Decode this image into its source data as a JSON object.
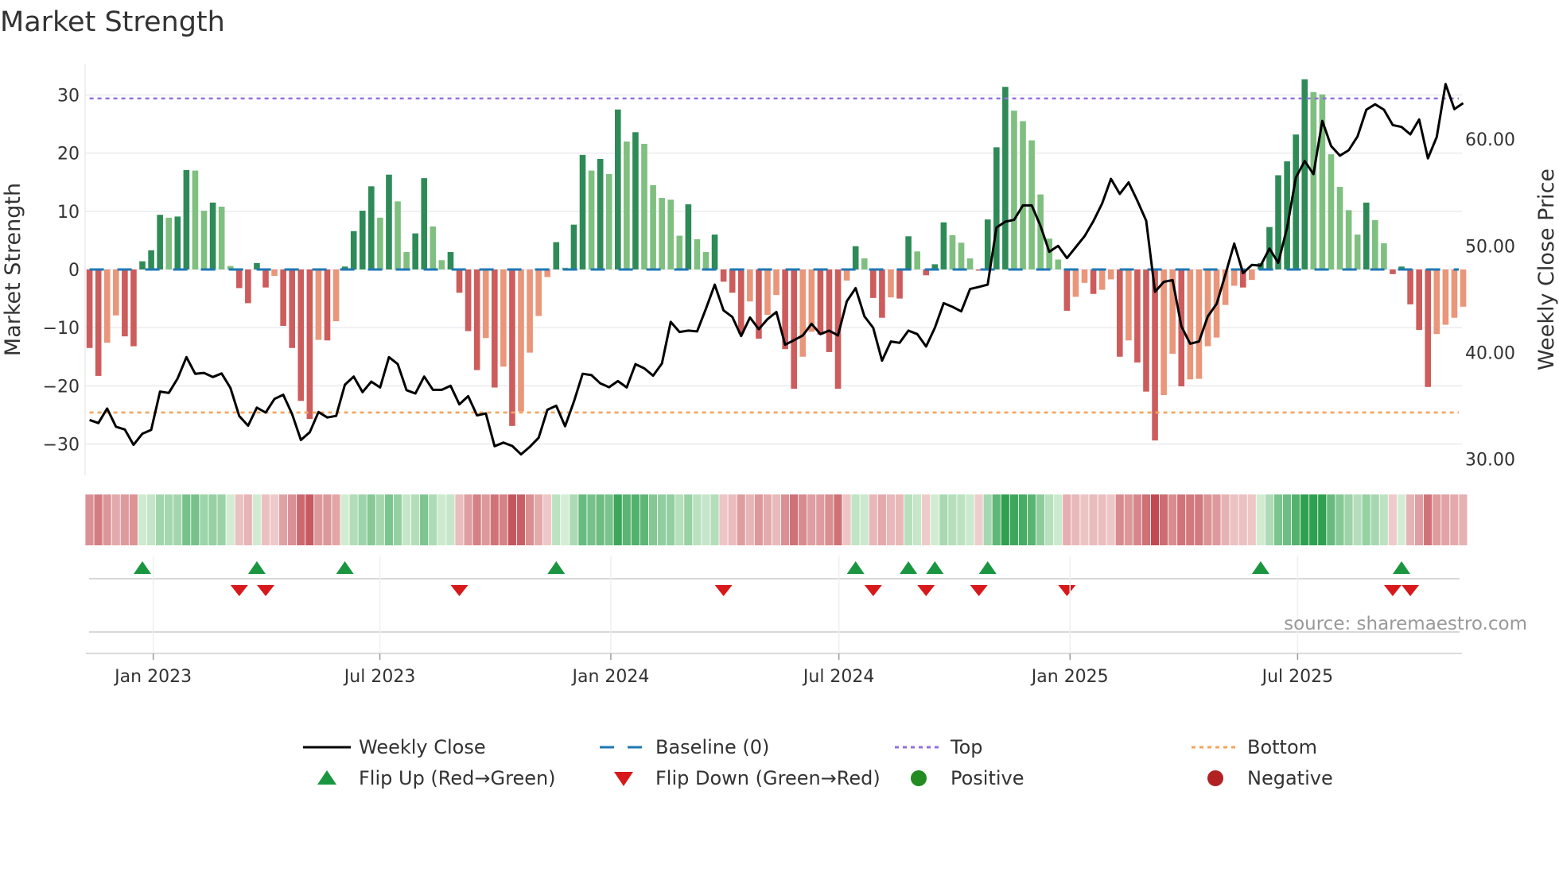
{
  "title": "Market Strength",
  "source": "source: sharemaestro.com",
  "colors": {
    "pos_strong": "#2e8b57",
    "pos_weak": "#7fbf7f",
    "neg_strong": "#cd5c5c",
    "neg_weak": "#e9967a",
    "baseline": "#1f77b4",
    "top": "#9370db",
    "bottom": "#f4a460",
    "flip_up": "#1a9641",
    "flip_down": "#d7191c",
    "line": "#000000"
  },
  "chart_data": {
    "type": "bar",
    "title": "Market Strength",
    "ylabel": "Market Strength",
    "y2label": "Weekly Close Price",
    "ylim": [
      -35.4,
      35.26
    ],
    "y2lim": [
      28.47,
      67.02
    ],
    "yticks": [
      30,
      20,
      10,
      0,
      -10,
      -20,
      -30
    ],
    "ytick_labels": [
      "30",
      "20",
      "10",
      "0",
      "−10",
      "−20",
      "−30"
    ],
    "y2ticks": [
      60,
      50,
      40,
      30
    ],
    "y2tick_labels": [
      "60.00",
      "50.00",
      "40.00",
      "30.00"
    ],
    "xticks": [
      7.23,
      32.97,
      59.2,
      85.1,
      111.35,
      137.2
    ],
    "xtick_labels": [
      "Jan 2023",
      "Jul 2023",
      "Jan 2024",
      "Jul 2024",
      "Jan 2025",
      "Jul 2025"
    ],
    "top_level": 29.4,
    "bottom_level": -24.6,
    "baseline": 0,
    "strength": [
      -13.5,
      -18.3,
      -12.6,
      -7.9,
      -11.5,
      -13.2,
      1.4,
      3.3,
      9.4,
      8.9,
      9.1,
      17.1,
      17.0,
      10.1,
      11.5,
      10.8,
      0.6,
      -3.2,
      -5.8,
      1.1,
      -3.1,
      -1.1,
      -9.7,
      -13.5,
      -22.6,
      -25.7,
      -12.1,
      -12.2,
      -8.9,
      0.5,
      6.6,
      10.1,
      14.3,
      8.9,
      16.3,
      11.7,
      3.0,
      6.2,
      15.7,
      7.4,
      1.6,
      3.0,
      -4.0,
      -10.6,
      -17.3,
      -11.8,
      -20.3,
      -16.7,
      -26.9,
      -24.4,
      -14.3,
      -8.0,
      -1.3,
      4.7,
      0.3,
      7.7,
      19.7,
      17.0,
      19.0,
      16.4,
      27.5,
      22.0,
      23.6,
      21.6,
      14.5,
      12.3,
      12.0,
      5.8,
      11.2,
      5.2,
      3.0,
      6.0,
      -2.1,
      -4.0,
      -11.0,
      -5.5,
      -11.9,
      -7.8,
      -4.4,
      -13.7,
      -20.5,
      -15.0,
      -10.7,
      -11.2,
      -14.2,
      -20.5,
      -1.9,
      4.0,
      1.9,
      -4.9,
      -8.3,
      -4.8,
      -5.0,
      5.7,
      3.1,
      -1.0,
      0.9,
      8.1,
      5.9,
      4.6,
      1.9,
      -0.2,
      8.6,
      21.0,
      31.4,
      27.3,
      25.5,
      22.2,
      12.9,
      5.3,
      1.7,
      -7.1,
      -4.7,
      -2.3,
      -4.2,
      -3.5,
      -1.7,
      -15.0,
      -12.2,
      -16.0,
      -21.0,
      -29.4,
      -21.6,
      -14.5,
      -20.1,
      -18.9,
      -18.8,
      -13.2,
      -11.7,
      -6.1,
      -2.8,
      -3.1,
      -1.8,
      1.1,
      7.3,
      16.2,
      18.6,
      23.2,
      32.7,
      30.5,
      30.1,
      19.8,
      14.2,
      10.2,
      6.0,
      11.5,
      8.5,
      4.5,
      -0.8,
      0.5,
      -6.0,
      -10.4,
      -20.2,
      -11.1,
      -9.5,
      -8.3,
      -6.4
    ],
    "weekly_close": [
      33.67,
      33.38,
      34.74,
      33.03,
      32.77,
      31.33,
      32.38,
      32.74,
      36.33,
      36.2,
      37.56,
      39.56,
      38.0,
      38.08,
      37.69,
      38.03,
      36.67,
      34.03,
      33.13,
      34.82,
      34.36,
      35.64,
      36.03,
      34.23,
      31.79,
      32.51,
      34.41,
      33.9,
      34.05,
      36.97,
      37.74,
      36.28,
      37.26,
      36.72,
      39.56,
      38.92,
      36.46,
      36.15,
      37.74,
      36.49,
      36.49,
      36.87,
      35.13,
      35.9,
      34.1,
      34.28,
      31.21,
      31.54,
      31.23,
      30.44,
      31.15,
      32.0,
      34.62,
      35.0,
      33.08,
      35.38,
      38.0,
      37.87,
      37.1,
      36.74,
      37.31,
      36.72,
      38.9,
      38.51,
      37.82,
      38.97,
      42.87,
      41.92,
      42.05,
      41.97,
      44.1,
      46.36,
      43.95,
      43.33,
      41.54,
      43.28,
      42.18,
      43.13,
      43.79,
      40.72,
      41.15,
      41.59,
      42.69,
      41.72,
      42.05,
      41.59,
      44.79,
      46.03,
      43.38,
      42.31,
      39.23,
      41.03,
      40.9,
      42.05,
      41.72,
      40.56,
      42.31,
      44.62,
      44.28,
      43.85,
      45.95,
      46.15,
      46.36,
      51.72,
      52.26,
      52.44,
      53.79,
      53.79,
      51.85,
      49.44,
      50.0,
      48.85,
      49.87,
      50.9,
      52.31,
      53.97,
      56.28,
      54.87,
      55.95,
      54.23,
      52.36,
      45.69,
      46.62,
      46.79,
      42.44,
      40.82,
      41.03,
      43.38,
      44.56,
      47.31,
      50.21,
      47.44,
      48.21,
      48.15,
      49.74,
      48.41,
      51.67,
      56.41,
      57.95,
      56.72,
      61.72,
      59.36,
      58.46,
      58.97,
      60.26,
      62.77,
      63.28,
      62.77,
      61.33,
      61.15,
      60.46,
      61.85,
      58.21,
      60.21,
      65.18,
      62.82,
      63.38
    ],
    "legend": {
      "placement": "bottom-center",
      "items": [
        {
          "label": "Weekly Close",
          "symbol": "line"
        },
        {
          "label": "Baseline (0)",
          "symbol": "dash"
        },
        {
          "label": "Top",
          "symbol": "dot-purple"
        },
        {
          "label": "Bottom",
          "symbol": "dot-orange"
        },
        {
          "label": "Flip Up (Red→Green)",
          "symbol": "triangle-up"
        },
        {
          "label": "Flip Down (Green→Red)",
          "symbol": "triangle-down"
        },
        {
          "label": "Positive",
          "symbol": "circle-green"
        },
        {
          "label": "Negative",
          "symbol": "circle-red"
        }
      ]
    }
  }
}
